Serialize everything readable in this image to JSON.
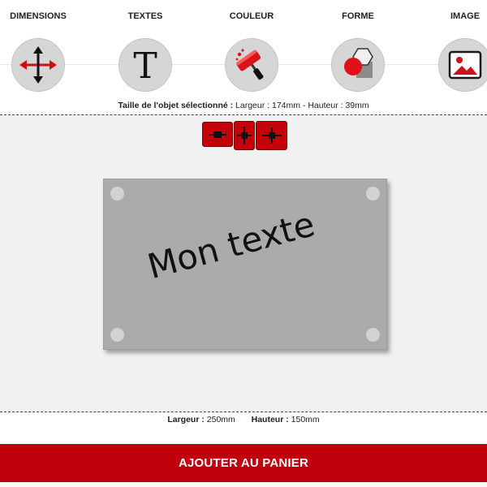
{
  "tools": [
    {
      "label": "DIMENSIONS",
      "icon": "resize-arrows-icon"
    },
    {
      "label": "TEXTES",
      "icon": "text-t-icon"
    },
    {
      "label": "COULEUR",
      "icon": "paint-roller-icon"
    },
    {
      "label": "FORME",
      "icon": "shapes-icon"
    },
    {
      "label": "IMAGE",
      "icon": "picture-icon"
    }
  ],
  "selection": {
    "prefix": "Taille de l'objet sélectionné :",
    "value": "Largeur : 174mm - Hauteur : 39mm"
  },
  "zoom": {
    "buttons": [
      {
        "name": "shrink",
        "icon": "minus-icon"
      },
      {
        "name": "reset",
        "icon": "plus-narrow-icon"
      },
      {
        "name": "grow",
        "icon": "plus-icon"
      }
    ]
  },
  "plate": {
    "text": "Mon texte",
    "background": "#ababab",
    "text_color": "#111111"
  },
  "dimensions": {
    "width_label": "Largeur :",
    "width_value": "250mm",
    "height_label": "Hauteur :",
    "height_value": "150mm"
  },
  "cart": {
    "label": "AJOUTER AU PANIER"
  },
  "colors": {
    "accent": "#c0000c",
    "tool_circle": "#d6d6d6",
    "workspace": "#f1f1f1"
  }
}
